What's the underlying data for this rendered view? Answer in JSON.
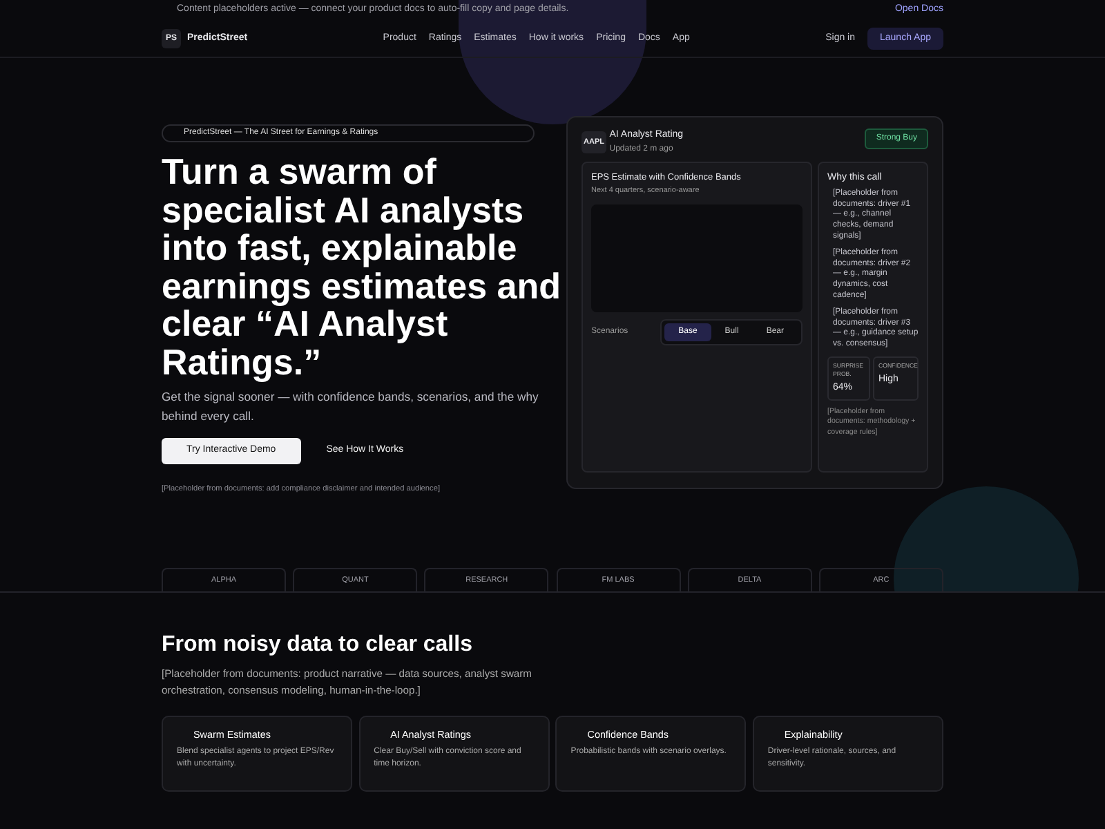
{
  "banner": {
    "text": "Content placeholders active — connect your product docs to auto-fill copy and page details.",
    "link": "Open Docs"
  },
  "nav": {
    "logo_mark": "PS",
    "brand": "PredictStreet",
    "links": [
      "Product",
      "Ratings",
      "Estimates",
      "How it works",
      "Pricing",
      "Docs",
      "App"
    ],
    "sign_in": "Sign in",
    "cta": "Launch App"
  },
  "hero": {
    "eyebrow": "PredictStreet — The AI Street for Earnings & Ratings",
    "title": "Turn a swarm of specialist AI analysts into fast, explainable earnings estimates and clear “AI Analyst Ratings.”",
    "subtitle": "Get the signal sooner — with confidence bands, scenarios, and the why behind every call.",
    "primary_button": "Try Interactive Demo",
    "secondary_button": "See How It Works",
    "disclaimer": "[Placeholder from documents: add compliance disclaimer and intended audience]"
  },
  "rating_card": {
    "ticker": "AAPL",
    "title": "AI Analyst Rating",
    "updated": "Updated 2 m ago",
    "rating": "Strong Buy",
    "estimate": {
      "title": "EPS Estimate with Confidence Bands",
      "subtitle": "Next 4 quarters, scenario-aware",
      "scenarios_label": "Scenarios",
      "scenarios": [
        {
          "label": "Base",
          "selected": true
        },
        {
          "label": "Bull",
          "selected": false
        },
        {
          "label": "Bear",
          "selected": false
        }
      ]
    },
    "why": {
      "title": "Why this call",
      "reasons": [
        "[Placeholder from documents: driver #1 — e.g., channel checks, demand signals]",
        "[Placeholder from documents: driver #2 — e.g., margin dynamics, cost cadence]",
        "[Placeholder from documents: driver #3 — e.g., guidance setup vs. consensus]"
      ],
      "stats": [
        {
          "label": "SURPRISE PROB.",
          "value": "64%"
        },
        {
          "label": "CONFIDENCE",
          "value": "High"
        }
      ],
      "note": "[Placeholder from documents: methodology + coverage rules]"
    }
  },
  "logos": [
    "ALPHA",
    "QUANT",
    "RESEARCH",
    "FM LABS",
    "DELTA",
    "ARC"
  ],
  "features_section": {
    "title": "From noisy data to clear calls",
    "intro": "[Placeholder from documents: product narrative — data sources, analyst swarm orchestration, consensus modeling, human-in-the-loop.]",
    "cards": [
      {
        "title": "Swarm Estimates",
        "text": "Blend specialist agents to project EPS/Rev with uncertainty."
      },
      {
        "title": "AI Analyst Ratings",
        "text": "Clear Buy/Sell with conviction score and time horizon."
      },
      {
        "title": "Confidence Bands",
        "text": "Probabilistic bands with scenario overlays."
      },
      {
        "title": "Explainability",
        "text": "Driver-level rationale, sources, and sensitivity."
      }
    ]
  }
}
